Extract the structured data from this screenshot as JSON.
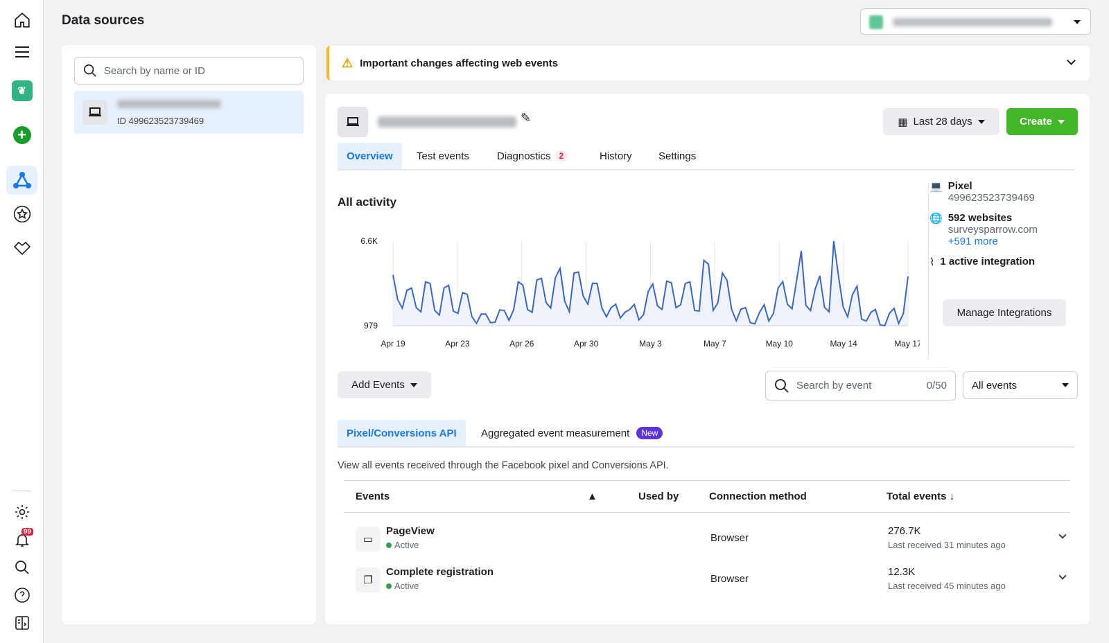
{
  "rail": {
    "icons": [
      "home-icon",
      "menu-icon",
      "app-logo-icon",
      "add-icon",
      "events-manager-icon",
      "star-icon",
      "partner-icon",
      "settings-icon",
      "notifications-icon",
      "search-icon",
      "help-icon",
      "panel-icon"
    ],
    "notif_count": "99"
  },
  "page_title": "Data sources",
  "left": {
    "search_placeholder": "Search by name or ID",
    "selected_id": "ID 499623523739469"
  },
  "banner": {
    "text": "Important changes affecting web events"
  },
  "header": {
    "date_range": "Last 28 days",
    "create": "Create"
  },
  "tabs": [
    {
      "label": "Overview"
    },
    {
      "label": "Test events"
    },
    {
      "label": "Diagnostics",
      "badge": "2"
    },
    {
      "label": "History"
    },
    {
      "label": "Settings"
    }
  ],
  "activity": {
    "title": "All activity"
  },
  "chart_data": {
    "type": "area",
    "yticks": [
      "6.6K",
      "979"
    ],
    "ylim": [
      979,
      6600
    ],
    "xticks": [
      "Apr 19",
      "Apr 23",
      "Apr 26",
      "Apr 30",
      "May 3",
      "May 7",
      "May 10",
      "May 14",
      "May 17"
    ],
    "grid": "vertical",
    "color": "#3b66c4",
    "values": [
      4358,
      2715,
      2146,
      3329,
      3483,
      2177,
      1901,
      3897,
      3790,
      1993,
      1686,
      3483,
      3667,
      1947,
      1793,
      3175,
      3068,
      1593,
      1133,
      1747,
      1747,
      1179,
      1209,
      2023,
      1993,
      1332,
      2023,
      3897,
      3682,
      2054,
      1870,
      4020,
      4128,
      2515,
      2146,
      4174,
      4788,
      2607,
      1916,
      4481,
      4543,
      2945,
      2407,
      3805,
      3790,
      2177,
      1563,
      2177,
      2407,
      1486,
      1870,
      2054,
      2392,
      1363,
      1716,
      3252,
      3759,
      2300,
      2054,
      3943,
      3836,
      2177,
      2377,
      3790,
      3897,
      1993,
      1947,
      5326,
      5065,
      1993,
      2484,
      4481,
      3990,
      2054,
      1302,
      2085,
      2177,
      1179,
      1102,
      1870,
      2377,
      1286,
      1793,
      3483,
      3913,
      2407,
      2100,
      4020,
      5940,
      2331,
      1977,
      3406,
      4297,
      2208,
      1901,
      6600,
      4327,
      2254,
      1563,
      3022,
      3606,
      1409,
      1286,
      1870,
      2054,
      1025,
      979,
      1793,
      2131,
      1133,
      1793,
      4251
    ]
  },
  "side": {
    "pixel_label": "Pixel",
    "pixel_id": "499623523739469",
    "websites": "592 websites",
    "website": "surveysparrow.com",
    "more": "+591 more",
    "integration": "1 active integration",
    "manage": "Manage Integrations"
  },
  "events_toolbar": {
    "add": "Add Events",
    "search_placeholder": "Search by event",
    "count": "0/50",
    "filter": "All events"
  },
  "subtabs": [
    {
      "label": "Pixel/Conversions API"
    },
    {
      "label": "Aggregated event measurement",
      "badge": "New"
    }
  ],
  "description": "View all events received through the Facebook pixel and Conversions API.",
  "table": {
    "headers": [
      "Events",
      "Used by",
      "Connection method",
      "Total events ↓"
    ],
    "rows": [
      {
        "name": "PageView",
        "status": "Active",
        "method": "Browser",
        "total": "276.7K",
        "last": "Last received 31 minutes ago"
      },
      {
        "name": "Complete registration",
        "status": "Active",
        "method": "Browser",
        "total": "12.3K",
        "last": "Last received 45 minutes ago"
      }
    ]
  }
}
